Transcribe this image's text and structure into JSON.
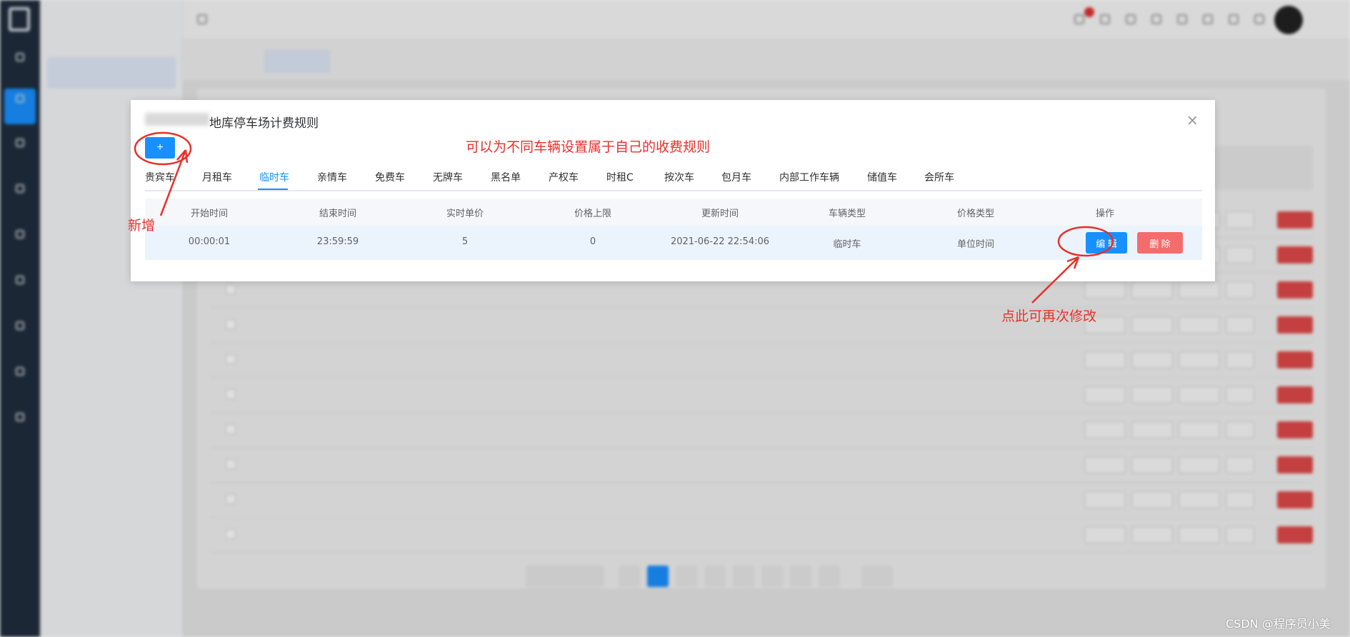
{
  "modal": {
    "title": "地库停车场计费规则",
    "add_label": "+",
    "close_glyph": "×",
    "tabs": [
      "贵宾车",
      "月租车",
      "临时车",
      "亲情车",
      "免费车",
      "无牌车",
      "黑名单",
      "产权车",
      "时租C",
      "按次车",
      "包月车",
      "内部工作车辆",
      "储值车",
      "会所车"
    ],
    "active_tab": "临时车",
    "columns": [
      "开始时间",
      "结束时间",
      "实时单价",
      "价格上限",
      "更新时间",
      "车辆类型",
      "价格类型",
      "操作"
    ],
    "rows": [
      {
        "start": "00:00:01",
        "end": "23:59:59",
        "unit_price": "5",
        "max_price": "0",
        "updated": "2021-06-22 22:54:06",
        "vehicle_type": "临时车",
        "price_type": "单位时间",
        "edit_label": "编 辑",
        "delete_label": "删 除"
      }
    ]
  },
  "annotations": {
    "top_note": "可以为不同车辆设置属于自己的收费规则",
    "add_note": "新增",
    "edit_note": "点此可再次修改",
    "color": "#e8302a"
  },
  "watermark": "CSDN @程序员小美",
  "colors": {
    "primary": "#1890ff",
    "danger": "#f56c6c"
  }
}
